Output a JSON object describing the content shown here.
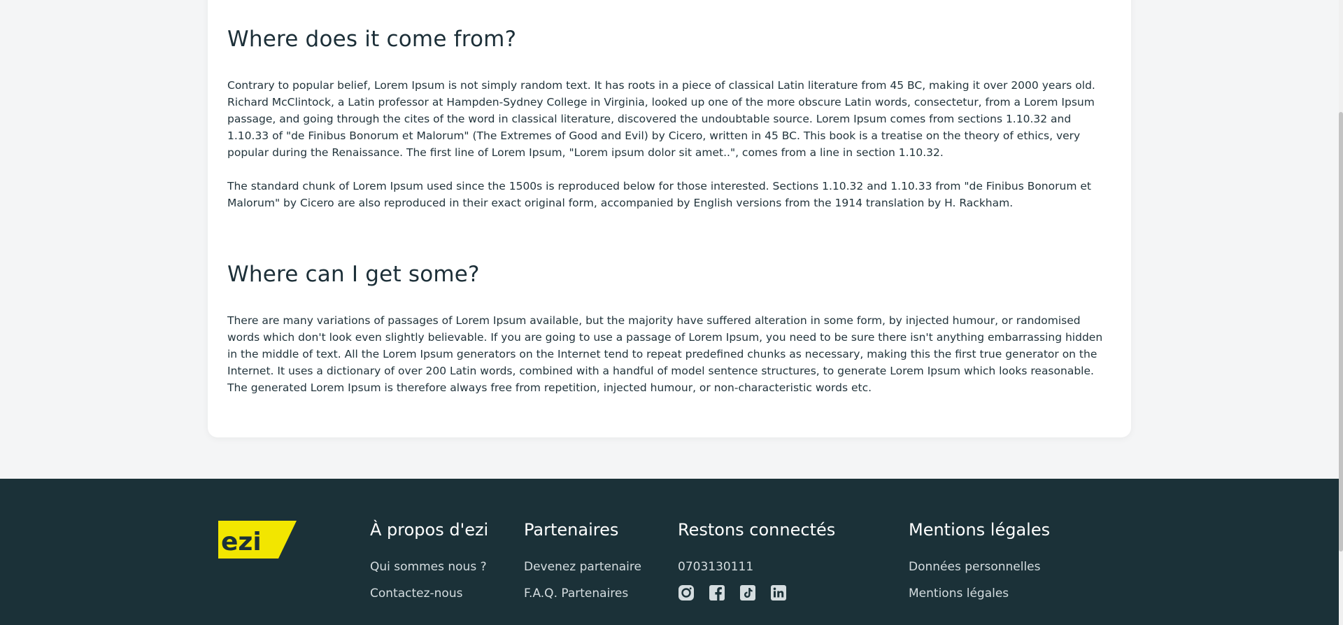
{
  "article": {
    "sections": [
      {
        "title": "Where does it come from?",
        "paragraphs": [
          "Contrary to popular belief, Lorem Ipsum is not simply random text. It has roots in a piece of classical Latin literature from 45 BC, making it over 2000 years old. Richard McClintock, a Latin professor at Hampden-Sydney College in Virginia, looked up one of the more obscure Latin words, consectetur, from a Lorem Ipsum passage, and going through the cites of the word in classical literature, discovered the undoubtable source. Lorem Ipsum comes from sections 1.10.32 and 1.10.33 of \"de Finibus Bonorum et Malorum\" (The Extremes of Good and Evil) by Cicero, written in 45 BC. This book is a treatise on the theory of ethics, very popular during the Renaissance. The first line of Lorem Ipsum, \"Lorem ipsum dolor sit amet..\", comes from a line in section 1.10.32.",
          "The standard chunk of Lorem Ipsum used since the 1500s is reproduced below for those interested. Sections 1.10.32 and 1.10.33 from \"de Finibus Bonorum et Malorum\" by Cicero are also reproduced in their exact original form, accompanied by English versions from the 1914 translation by H. Rackham."
        ]
      },
      {
        "title": "Where can I get some?",
        "paragraphs": [
          "There are many variations of passages of Lorem Ipsum available, but the majority have suffered alteration in some form, by injected humour, or randomised words which don't look even slightly believable. If you are going to use a passage of Lorem Ipsum, you need to be sure there isn't anything embarrassing hidden in the middle of text. All the Lorem Ipsum generators on the Internet tend to repeat predefined chunks as necessary, making this the first true generator on the Internet. It uses a dictionary of over 200 Latin words, combined with a handful of model sentence structures, to generate Lorem Ipsum which looks reasonable. The generated Lorem Ipsum is therefore always free from repetition, injected humour, or non-characteristic words etc."
        ]
      }
    ]
  },
  "footer": {
    "logo_text": "ezi",
    "colors": {
      "background": "#1b3138",
      "logo_yellow": "#f2e600"
    },
    "about": {
      "title": "À propos d'ezi",
      "links": [
        "Qui sommes nous ?",
        "Contactez-nous"
      ]
    },
    "partners": {
      "title": "Partenaires",
      "links": [
        "Devenez partenaire",
        "F.A.Q. Partenaires"
      ]
    },
    "connect": {
      "title": "Restons connectés",
      "phone": "0703130111",
      "socials": [
        "instagram-icon",
        "facebook-icon",
        "tiktok-icon",
        "linkedin-icon"
      ]
    },
    "legal": {
      "title": "Mentions légales",
      "links": [
        "Données personnelles",
        "Mentions légales"
      ]
    }
  }
}
